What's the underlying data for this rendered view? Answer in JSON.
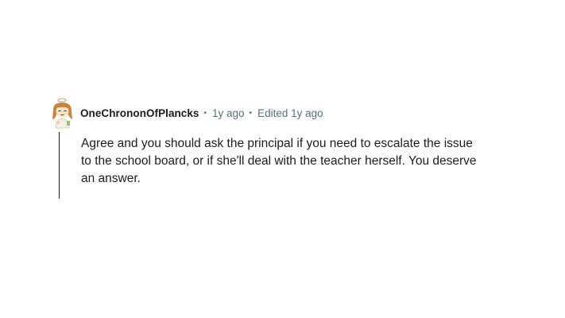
{
  "comment": {
    "author": "OneChrononOfPlancks",
    "posted": "1y ago",
    "edited": "Edited 1y ago",
    "separator": "•",
    "body_lines": [
      "Agree and you should ask the principal if you need to escalate the issue",
      "to the school board, or if she'll deal with the teacher herself. You deserve",
      "an answer."
    ],
    "avatar_icon": "user-avatar-icon"
  },
  "colors": {
    "text": "#1c1c1c",
    "meta": "#576f76",
    "background": "#ffffff"
  }
}
